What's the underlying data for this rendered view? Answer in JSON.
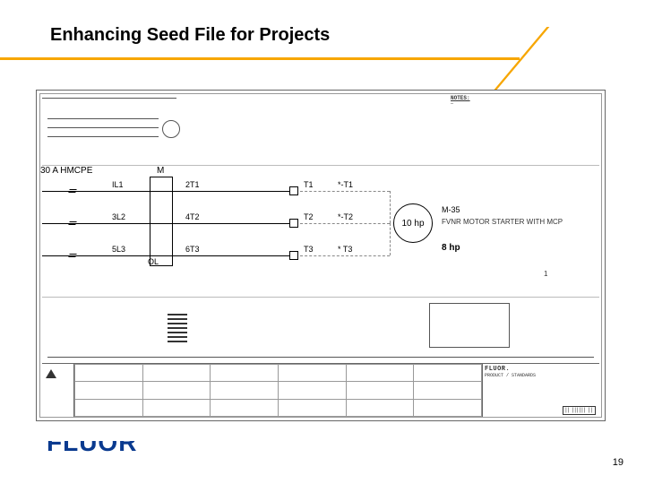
{
  "slide": {
    "title": "Enhancing Seed File for Projects",
    "page_number": "19",
    "logo_text": "FLUOR",
    "logo_reg": "®"
  },
  "schematic": {
    "notes_heading": "NOTES:",
    "notes_body": "—",
    "breaker_label": "30 A HMCPE",
    "column_m": "M",
    "lines": {
      "l1": "IL1",
      "l2": "3L2",
      "l3": "5L3",
      "t1a": "2T1",
      "t2a": "4T2",
      "t3a": "6T3"
    },
    "ol_label": "OL",
    "terminals": {
      "t1": "T1",
      "t2": "T2",
      "t3": "T3",
      "t1s": "*-T1",
      "t2s": "*-T2",
      "t3s": "* T3"
    },
    "motor_text": "10 hp",
    "motor_tag": "M-35",
    "motor_desc": "FVNR MOTOR STARTER WITH MCP",
    "load_hp": "8 hp",
    "one": "1"
  },
  "titleblock": {
    "brand": "FLUOR.",
    "subtitle": "PRODUCT / STANDARDS",
    "dwg_no": "||  |||||| ||",
    "cells": [
      [
        "",
        "",
        "",
        "",
        "",
        ""
      ],
      [
        "",
        "",
        "",
        "",
        "",
        ""
      ],
      [
        "",
        "",
        "",
        "",
        "",
        ""
      ]
    ]
  }
}
